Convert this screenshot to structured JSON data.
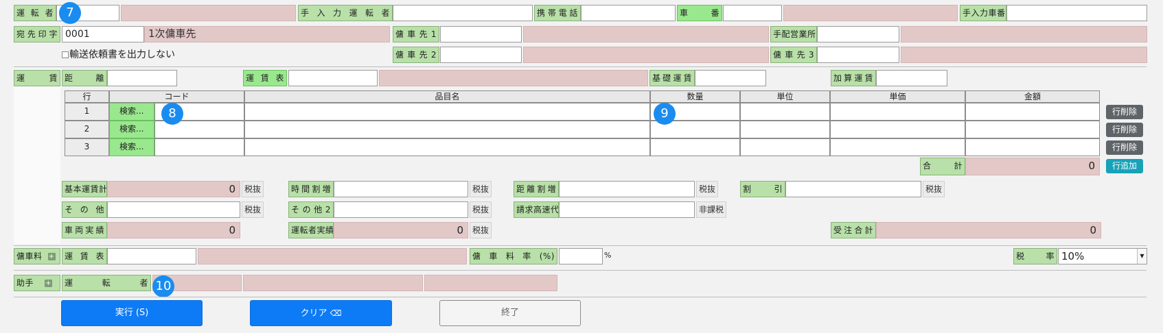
{
  "row1": {
    "driver_label": "運転者",
    "manual_driver_label": "手入力運転者",
    "mobile_label": "携帯電話",
    "vehicle_no_label": "車番",
    "manual_vehicle_label": "手入力車番"
  },
  "row2": {
    "dest_stamp_label": "宛先印字",
    "dest_stamp_value": "0001",
    "dest_stamp_text": "1次傭車先",
    "charter1_label": "傭車先1",
    "arrange_office_label": "手配営業所"
  },
  "row3": {
    "no_transport_request_label": "輸送依頼書を出力しない",
    "charter2_label": "傭車先2",
    "charter3_label": "傭車先3"
  },
  "fare": {
    "section_label": "運賃",
    "distance_label": "距離",
    "fare_table_label": "運賃表",
    "base_fare_label": "基礎運賃",
    "extra_fare_label": "加算運賃"
  },
  "items_table": {
    "headers": [
      "行",
      "コード",
      "品目名",
      "数量",
      "単位",
      "単価",
      "金額"
    ],
    "rows": [
      {
        "num": "1",
        "search": "検索..."
      },
      {
        "num": "2",
        "search": "検索..."
      },
      {
        "num": "3",
        "search": "検索..."
      }
    ],
    "delete_label": "行削除",
    "add_label": "行追加",
    "total_label": "合計",
    "total_value": "0"
  },
  "charges": {
    "base_total_label": "基本運賃計",
    "base_total_value": "0",
    "time_surcharge_label": "時間割増",
    "distance_surcharge_label": "距離割増",
    "discount_label": "割引",
    "other_label": "その他",
    "other2_label": "その他2",
    "highway_label": "請求高速代",
    "vehicle_actual_label": "車両実績",
    "vehicle_actual_value": "0",
    "driver_actual_label": "運転者実績",
    "driver_actual_value": "0",
    "order_total_label": "受注合計",
    "order_total_value": "0",
    "tax_excl": "税抜",
    "non_taxable": "非課税"
  },
  "charter_fee": {
    "section_label": "傭車料",
    "fare_table_label": "運賃表",
    "rate_label": "傭車料率(%)",
    "percent": "%",
    "tax_rate_label": "税率",
    "tax_rate_value": "10%"
  },
  "assistant": {
    "section_label": "助手",
    "driver_label": "運転者"
  },
  "buttons": {
    "execute": "実行 (S)",
    "clear": "クリア",
    "clear_icon": "⌫",
    "close": "終了"
  },
  "badges": [
    "7",
    "8",
    "9",
    "10"
  ],
  "icons": {
    "expand": "plus-square-icon",
    "eraser": "eraser-icon",
    "dropdown": "chevron-down-icon"
  }
}
